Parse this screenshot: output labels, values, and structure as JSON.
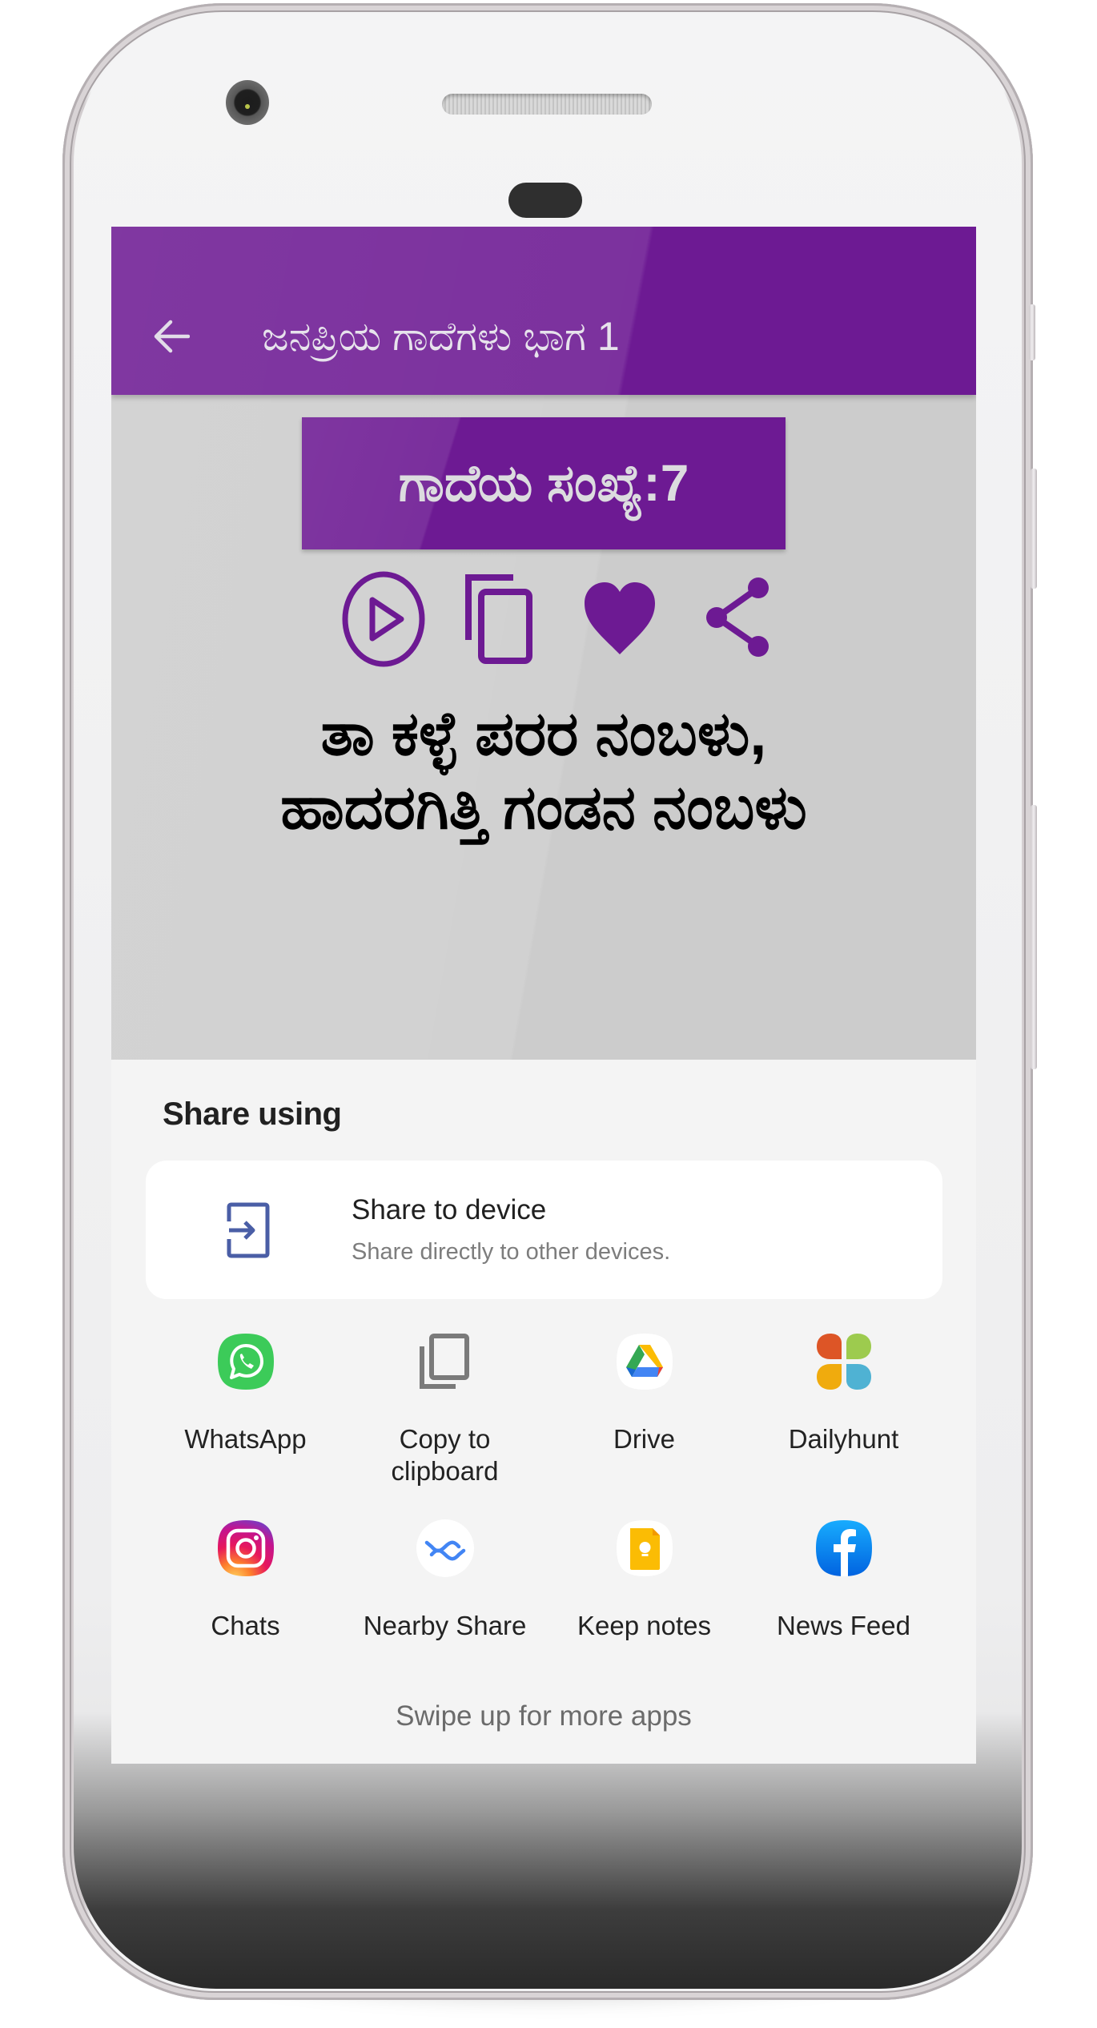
{
  "device": {
    "frame": "android-phone"
  },
  "toolbar": {
    "back_icon": "arrow-left-icon",
    "title": "ಜನಪ್ರಿಯ ಗಾದೆಗಳು ಭಾಗ 1",
    "color": "#6d1a93"
  },
  "proverb_badge": {
    "label": "ಗಾದೆಯ ಸಂಖ್ಯೆ:7",
    "number": 7
  },
  "actions": [
    {
      "name": "play",
      "icon": "play-circle-icon"
    },
    {
      "name": "copy",
      "icon": "copy-icon"
    },
    {
      "name": "favorite",
      "icon": "heart-icon"
    },
    {
      "name": "share",
      "icon": "share-icon"
    }
  ],
  "proverb": {
    "line1": "ತಾ ಕಳ್ಳೆ ಪರರ ನಂಬಳು,",
    "line2": "ಹಾದರಗಿತ್ತಿ ಗಂಡನ ನಂಬಳು"
  },
  "share_sheet": {
    "title": "Share using",
    "device_share": {
      "title": "Share to device",
      "subtitle": "Share directly to other devices.",
      "icon": "share-to-device-icon"
    },
    "apps": [
      {
        "label": "WhatsApp",
        "icon": "whatsapp-icon"
      },
      {
        "label": "Copy to\nclipboard",
        "icon": "copy-to-clipboard-icon"
      },
      {
        "label": "Drive",
        "icon": "google-drive-icon"
      },
      {
        "label": "Dailyhunt",
        "icon": "dailyhunt-icon"
      },
      {
        "label": "Chats",
        "icon": "instagram-icon"
      },
      {
        "label": "Nearby Share",
        "icon": "nearby-share-icon"
      },
      {
        "label": "Keep notes",
        "icon": "google-keep-icon"
      },
      {
        "label": "News Feed",
        "icon": "facebook-icon"
      }
    ],
    "swipe_hint": "Swipe up for more apps"
  }
}
